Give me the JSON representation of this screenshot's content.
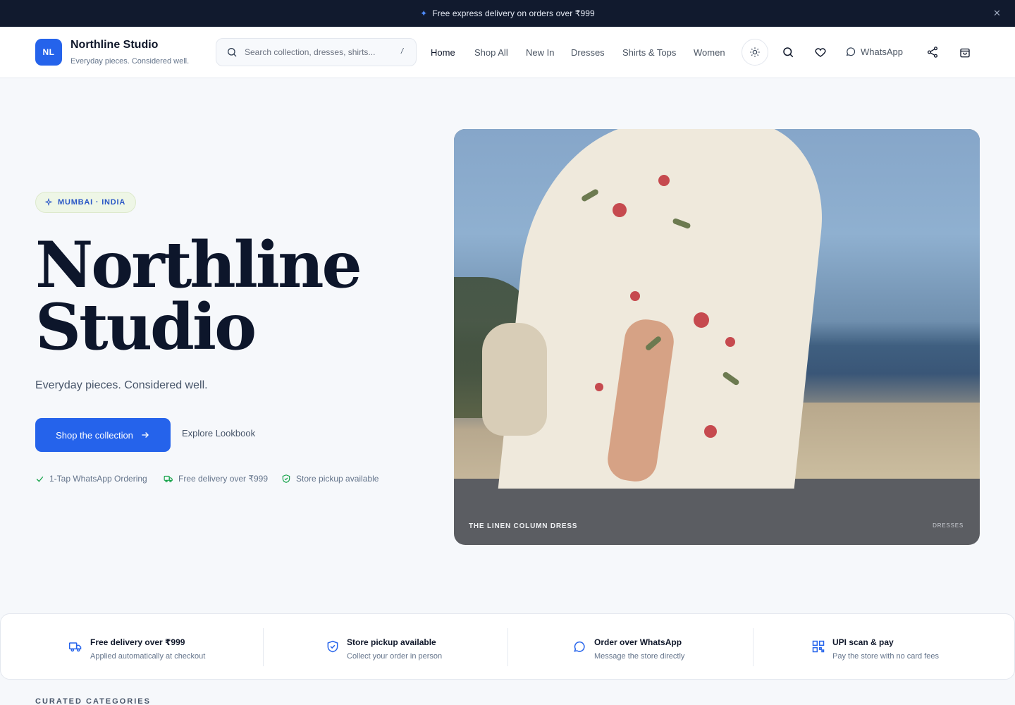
{
  "announcement": {
    "text": "Free express delivery on orders over ₹999",
    "close_icon": "close-icon"
  },
  "header": {
    "logo_initials": "NL",
    "brand_name": "Northline Studio",
    "tagline": "Everyday pieces. Considered well.",
    "search": {
      "placeholder": "Search collection, dresses, shirts...",
      "shortcut": "/"
    },
    "nav": [
      "Home",
      "Shop All",
      "New In",
      "Dresses",
      "Shirts & Tops",
      "Women"
    ],
    "active_nav": "Home",
    "whatsapp_label": "WhatsApp",
    "icons": [
      "theme-toggle-icon",
      "search-icon",
      "heart-icon",
      "whatsapp-icon",
      "share-icon",
      "bag-icon"
    ]
  },
  "hero": {
    "location_chip": "MUMBAI · INDIA",
    "title_line1": "Northline",
    "title_line2": "Studio",
    "subtitle": "Everyday pieces. Considered well.",
    "cta_label": "Shop the collection",
    "secondary_label": "Explore Lookbook",
    "perks": [
      "1-Tap WhatsApp Ordering",
      "Free delivery over ₹999",
      "Store pickup available"
    ],
    "card_caption": "THE LINEN COLUMN DRESS",
    "card_tag": "DRESSES"
  },
  "features": [
    {
      "title": "Free delivery over ₹999",
      "desc": "Applied automatically at checkout",
      "icon": "truck-icon"
    },
    {
      "title": "Store pickup available",
      "desc": "Collect your order in person",
      "icon": "shield-check-icon"
    },
    {
      "title": "Order over WhatsApp",
      "desc": "Message the store directly",
      "icon": "chat-icon"
    },
    {
      "title": "UPI scan & pay",
      "desc": "Pay the store with no card fees",
      "icon": "qr-code-icon"
    }
  ],
  "sections": {
    "curated_label": "CURATED CATEGORIES"
  },
  "colors": {
    "accent": "#2563eb",
    "announcement_bg": "#111a2e",
    "ink": "#0d162b",
    "chip_bg": "#eef6e6"
  }
}
